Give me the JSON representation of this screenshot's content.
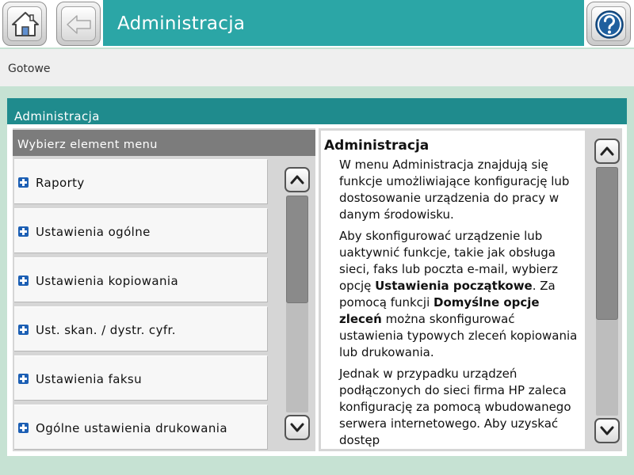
{
  "header": {
    "title": "Administracja",
    "home_icon": "home-icon",
    "back_icon": "back-arrow-icon",
    "help_icon": "help-icon"
  },
  "status": {
    "text": "Gotowe"
  },
  "panel": {
    "title": "Administracja",
    "menu_header": "Wybierz element menu",
    "menu_items": [
      {
        "label": "Raporty",
        "icon": "plus-icon"
      },
      {
        "label": "Ustawienia ogólne",
        "icon": "plus-icon"
      },
      {
        "label": "Ustawienia kopiowania",
        "icon": "plus-icon"
      },
      {
        "label": "Ust. skan. / dystr. cyfr.",
        "icon": "plus-icon"
      },
      {
        "label": "Ustawienia faksu",
        "icon": "plus-icon"
      },
      {
        "label": "Ogólne ustawienia drukowania",
        "icon": "plus-icon"
      }
    ]
  },
  "help": {
    "title": "Administracja",
    "paragraph1": "W menu Administracja znajdują się funkcje umożliwiające konfigurację lub dostosowanie urządzenia do pracy w danym środowisku.",
    "p2_a": "Aby skonfigurować urządzenie lub uaktywnić funkcje, takie jak obsługa sieci, faks lub poczta e-mail, wybierz opcję ",
    "p2_b1": "Ustawienia początkowe",
    "p2_c": ". Za pomocą funkcji ",
    "p2_b2": "Domyślne opcje zleceń",
    "p2_d": " można skonfigurować ustawienia typowych zleceń kopiowania lub drukowania.",
    "paragraph3": "Jednak w przypadku urządzeń podłączonych do sieci firma HP zaleca konfigurację za pomocą wbudowanego serwera internetowego. Aby uzyskać dostęp"
  },
  "colors": {
    "title_band": "#2ba6a6",
    "panel_header": "#1f8b8d",
    "menu_header": "#7c7c7c",
    "plus_icon": "#1c5fb4",
    "background": "#c6e2d3"
  }
}
